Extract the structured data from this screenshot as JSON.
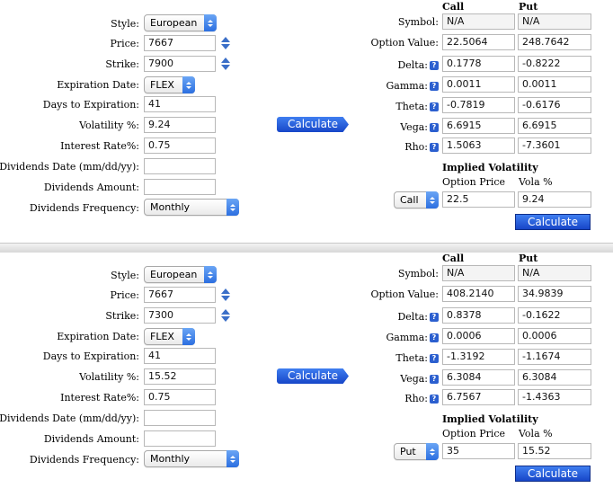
{
  "labels": {
    "style": "Style:",
    "price": "Price:",
    "strike": "Strike:",
    "expiration_date": "Expiration Date:",
    "days_to_expiration": "Days to Expiration:",
    "volatility": "Volatility %:",
    "interest_rate": "Interest Rate%:",
    "dividends_date": "Dividends Date (mm/dd/yy):",
    "dividends_amount": "Dividends Amount:",
    "dividends_frequency": "Dividends Frequency:",
    "call": "Call",
    "put": "Put",
    "symbol": "Symbol:",
    "option_value": "Option Value:",
    "delta": "Delta:",
    "gamma": "Gamma:",
    "theta": "Theta:",
    "vega": "Vega:",
    "rho": "Rho:",
    "implied_volatility": "Implied Volatility",
    "option_price": "Option Price",
    "vola_pct": "Vola %",
    "calculate": "Calculate",
    "help_glyph": "?"
  },
  "colors": {
    "button_blue": "#1f55d8",
    "stepper_blue": "#3b6fc8"
  },
  "panels": [
    {
      "inputs": {
        "style": "European",
        "price": "7667",
        "strike": "7900",
        "expiration": "FLEX",
        "days": "41",
        "volatility": "9.24",
        "interest": "0.75",
        "div_date": "",
        "div_amount": "",
        "div_freq": "Monthly"
      },
      "results": {
        "symbol_call": "N/A",
        "symbol_put": "N/A",
        "value_call": "22.5064",
        "value_put": "248.7642",
        "delta_call": "0.1778",
        "delta_put": "-0.8222",
        "gamma_call": "0.0011",
        "gamma_put": "0.0011",
        "theta_call": "-0.7819",
        "theta_put": "-0.6176",
        "vega_call": "6.6915",
        "vega_put": "6.6915",
        "rho_call": "1.5063",
        "rho_put": "-7.3601"
      },
      "iv": {
        "type": "Call",
        "price": "22.5",
        "vola": "9.24"
      }
    },
    {
      "inputs": {
        "style": "European",
        "price": "7667",
        "strike": "7300",
        "expiration": "FLEX",
        "days": "41",
        "volatility": "15.52",
        "interest": "0.75",
        "div_date": "",
        "div_amount": "",
        "div_freq": "Monthly"
      },
      "results": {
        "symbol_call": "N/A",
        "symbol_put": "N/A",
        "value_call": "408.2140",
        "value_put": "34.9839",
        "delta_call": "0.8378",
        "delta_put": "-0.1622",
        "gamma_call": "0.0006",
        "gamma_put": "0.0006",
        "theta_call": "-1.3192",
        "theta_put": "-1.1674",
        "vega_call": "6.3084",
        "vega_put": "6.3084",
        "rho_call": "6.7567",
        "rho_put": "-1.4363"
      },
      "iv": {
        "type": "Put",
        "price": "35",
        "vola": "15.52"
      }
    }
  ]
}
